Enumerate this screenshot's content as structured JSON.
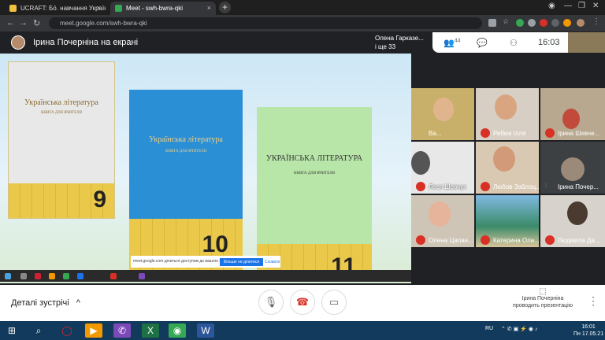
{
  "browser": {
    "tabs": [
      {
        "label": "UCRAFT: Бо́. навчання Україна, с",
        "active": false
      },
      {
        "label": "Meet - swh-bwra-qki",
        "active": true
      }
    ],
    "url": "meet.google.com/swh-bwra-qki"
  },
  "meet": {
    "presenter_label": "Ірина Почерніна на екрані",
    "attendee_line1": "Олена Гарказе...",
    "attendee_line2": "і ще 33",
    "participants_count": "44",
    "time": "16:03"
  },
  "slide": {
    "books": [
      {
        "title": "Українська література",
        "subtitle": "КНИГА ДЛЯ ВЧИТЕЛЯ",
        "grade": "9"
      },
      {
        "title": "Українська література",
        "subtitle": "КНИГА ДЛЯ ВЧИТЕЛЯ",
        "grade": "10"
      },
      {
        "title": "УКРАЇНСЬКА ЛІТЕРАТУРА",
        "subtitle": "КНИГА ДЛЯ ВЧИТЕЛЯ",
        "grade": "11"
      }
    ],
    "banner_text": "meet.google.com ділиться доступом до вашого екрана",
    "banner_stop": "Більше не ділитися",
    "banner_hide": "Сховати"
  },
  "participants": [
    {
      "name": "Ва..."
    },
    {
      "name": "Ребюк Ілля"
    },
    {
      "name": "Ірина Шевче..."
    },
    {
      "name": "Леся Шевчук"
    },
    {
      "name": "Любов Заблоц..."
    },
    {
      "name": "Ірина Почер..."
    },
    {
      "name": "Олена Цапан..."
    },
    {
      "name": "Катерина Ола..."
    },
    {
      "name": "Людмила Да..."
    }
  ],
  "controls": {
    "details_label": "Деталі зустрічі",
    "presenting_line1": "Ірина Почерніна",
    "presenting_line2": "проводить презентацію"
  },
  "taskbar": {
    "lang": "RU",
    "time": "16:01",
    "date": "Пн 17.05.21"
  }
}
